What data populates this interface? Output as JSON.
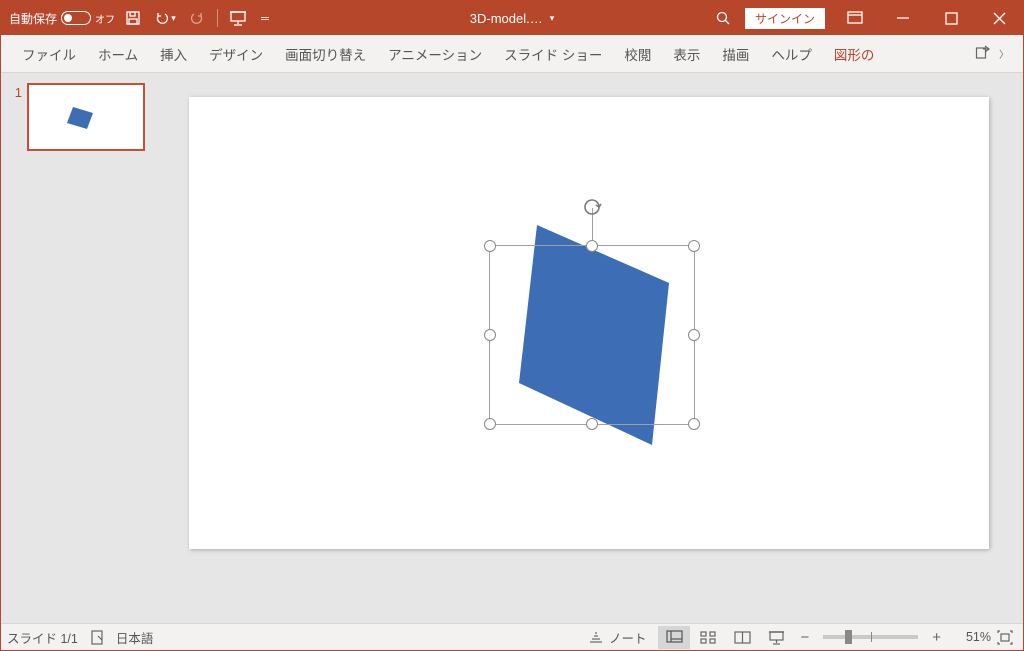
{
  "titlebar": {
    "autosave_label": "自動保存",
    "autosave_state": "オフ",
    "filename": "3D-model.…",
    "signin": "サインイン"
  },
  "ribbon": {
    "tabs": [
      "ファイル",
      "ホーム",
      "挿入",
      "デザイン",
      "画面切り替え",
      "アニメーション",
      "スライド ショー",
      "校閲",
      "表示",
      "描画",
      "ヘルプ",
      "図形の"
    ]
  },
  "thumbnails": {
    "items": [
      {
        "num": "1"
      }
    ]
  },
  "statusbar": {
    "slide_info": "スライド 1/1",
    "language": "日本語",
    "notes": "ノート",
    "zoom": "51%"
  }
}
